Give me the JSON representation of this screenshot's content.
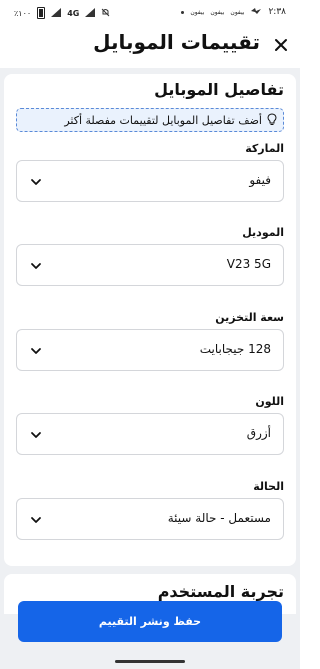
{
  "status_bar": {
    "time": "٢:٣٨",
    "apps": [
      "بيفون",
      "بيفون",
      "بيفون"
    ],
    "network": "4G",
    "battery": "٪١٠٠"
  },
  "header": {
    "title": "تقييمات الموبايل",
    "close_icon": "close-icon"
  },
  "details": {
    "title": "تفاصيل الموبايل",
    "hint": "أضف تفاصيل الموبايل لتقييمات مفصلة أكثر",
    "hint_icon": "lightbulb-icon",
    "fields": [
      {
        "label": "الماركة",
        "value": "فيفو"
      },
      {
        "label": "الموديل",
        "value": "V23 5G"
      },
      {
        "label": "سعة التخزين",
        "value": "128 جيجابايت"
      },
      {
        "label": "اللون",
        "value": "أزرق"
      },
      {
        "label": "الحالة",
        "value": "مستعمل - حالة سيئة"
      }
    ]
  },
  "user_experience": {
    "title": "تجربة المستخدم"
  },
  "save_button": "حفظ ونشر التقييم",
  "colors": {
    "accent": "#1565e8",
    "background": "#eef0f3",
    "hint_bg": "#eaf2fd"
  }
}
